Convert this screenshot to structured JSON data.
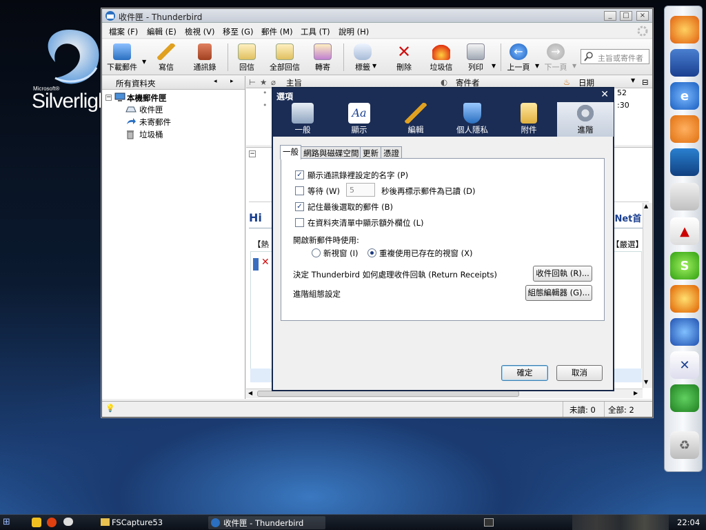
{
  "desktop": {
    "logo_top": "Microsoft®",
    "logo_word": "Silverligh"
  },
  "window": {
    "title": "收件匣 - Thunderbird",
    "menu": [
      "檔案 (F)",
      "編輯 (E)",
      "檢視 (V)",
      "移至 (G)",
      "郵件 (M)",
      "工具 (T)",
      "說明 (H)"
    ],
    "toolbar": [
      "下載郵件",
      "寫信",
      "通訊錄",
      "回信",
      "全部回信",
      "轉寄",
      "標籤",
      "刪除",
      "垃圾信",
      "列印",
      "上一頁",
      "下一頁"
    ],
    "search_placeholder": "主旨或寄件者",
    "folder_header": "所有資料夾",
    "folders": {
      "root": "本機郵件匣",
      "inbox": "收件匣",
      "unsent": "未寄郵件",
      "trash": "垃圾桶"
    },
    "thread_columns": {
      "subject": "主旨",
      "sender": "寄件者",
      "date": "日期"
    },
    "thread_times": [
      "52",
      ":30"
    ],
    "preview_fragments": {
      "logo": "Hi",
      "link": "iNet首",
      "left": "【熱",
      "right": "【嚴選】"
    },
    "status": {
      "unread": "未讀: 0",
      "total": "全部: 2"
    }
  },
  "dialog": {
    "title": "選項",
    "categories": [
      "一般",
      "顯示",
      "編輯",
      "個人隱私",
      "附件",
      "進階"
    ],
    "selected_category": "進階",
    "tabs": [
      "一般",
      "網路與磁碟空間",
      "更新",
      "憑證"
    ],
    "selected_tab": "一般",
    "opt1": "顯示通訊錄裡設定的名字 (P)",
    "opt2_prefix": "等待 (W)",
    "opt2_value": "5",
    "opt2_suffix": "秒後再標示郵件為已讀 (D)",
    "opt3": "記住最後選取的郵件 (B)",
    "opt4": "在資料夾清單中顯示額外欄位 (L)",
    "open_label": "開啟新郵件時使用:",
    "radio_new": "新視窗 (I)",
    "radio_reuse": "重複使用已存在的視窗 (X)",
    "receipts_text": "決定 Thunderbird 如何處理收件回執 (Return Receipts)",
    "receipts_btn": "收件回執 (R)...",
    "config_text": "進階組態設定",
    "config_btn": "組態編輯器 (G)...",
    "ok": "確定",
    "cancel": "取消"
  },
  "taskbar": {
    "task1": "FSCapture53",
    "task2": "收件匣 - Thunderbird",
    "clock": "22:04"
  }
}
